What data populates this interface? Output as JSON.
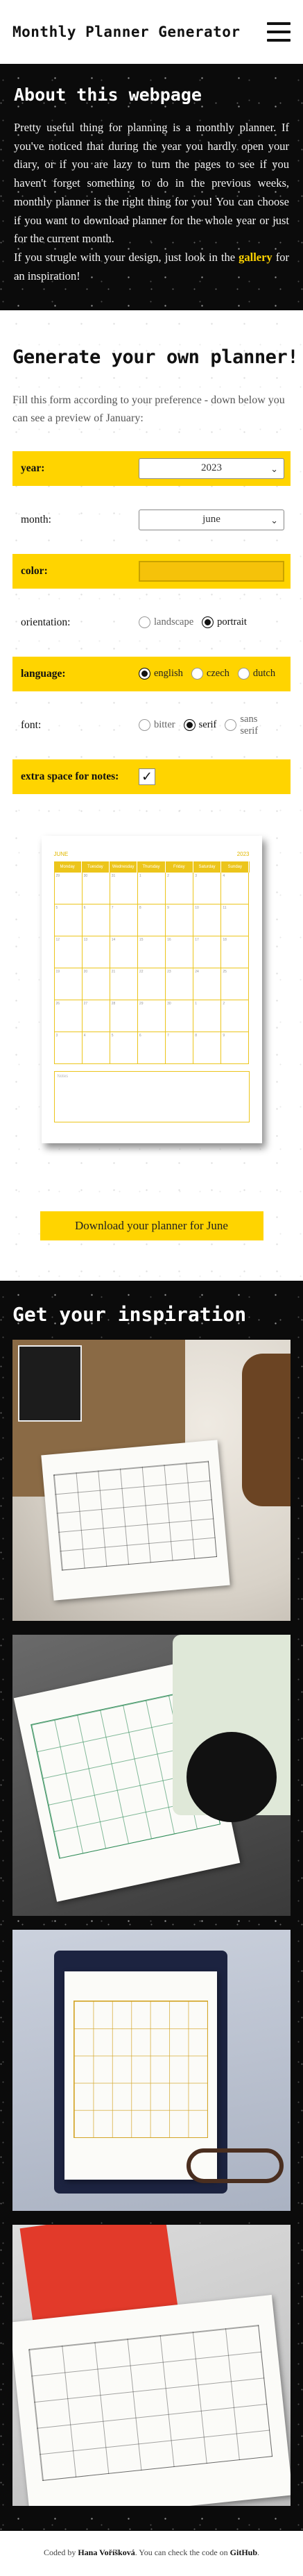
{
  "header": {
    "title": "Monthly Planner Generator",
    "menu_icon": "hamburger-menu-icon"
  },
  "about": {
    "heading": "About this webpage",
    "text_1": "Pretty useful thing for planning is a monthly planner. If you've noticed that during the year you hardly open your diary, or if you are lazy to turn the pages to see if you haven't forget something to do in the previous weeks, monthly planner is the right thing for you! You can choose if you want to download planner for the whole year or just for the current month.",
    "text_2a": "If you strugle with your design, just look in the ",
    "text_2_link": "gallery",
    "text_2b": " for an inspiration!"
  },
  "generator": {
    "heading": "Generate your own planner!",
    "intro": "Fill this form according to your preference - down below you can see a preview of January:",
    "year_label": "year:",
    "year_value": "2023",
    "month_label": "month:",
    "month_value": "june",
    "color_label": "color:",
    "color_value": "#f5c20a",
    "orientation_label": "orientation:",
    "orientation_options": [
      "landscape",
      "portrait"
    ],
    "orientation_selected": "portrait",
    "language_label": "language:",
    "language_options": [
      "english",
      "czech",
      "dutch"
    ],
    "language_selected": "english",
    "font_label": "font:",
    "font_options": [
      "bitter",
      "serif",
      "sans serif"
    ],
    "font_selected": "serif",
    "extra_label": "extra space for notes:",
    "extra_checked": true,
    "download_label": "Download your planner for June"
  },
  "preview": {
    "month": "JUNE",
    "year": "2023",
    "days": [
      "Monday",
      "Tuesday",
      "Wednesday",
      "Thursday",
      "Friday",
      "Saturday",
      "Sunday"
    ],
    "cells": [
      "29",
      "30",
      "31",
      "1",
      "2",
      "3",
      "4",
      "5",
      "6",
      "7",
      "8",
      "9",
      "10",
      "11",
      "12",
      "13",
      "14",
      "15",
      "16",
      "17",
      "18",
      "19",
      "20",
      "21",
      "22",
      "23",
      "24",
      "25",
      "26",
      "27",
      "28",
      "29",
      "30",
      "1",
      "2",
      "3",
      "4",
      "5",
      "6",
      "7",
      "8",
      "9"
    ],
    "notes_label": "Notes"
  },
  "inspiration": {
    "heading": "Get your inspiration"
  },
  "footer": {
    "prefix": "Coded by ",
    "author": "Hana Voříšková",
    "middle": ". You can check the code on ",
    "link": "GitHub",
    "suffix": "."
  }
}
